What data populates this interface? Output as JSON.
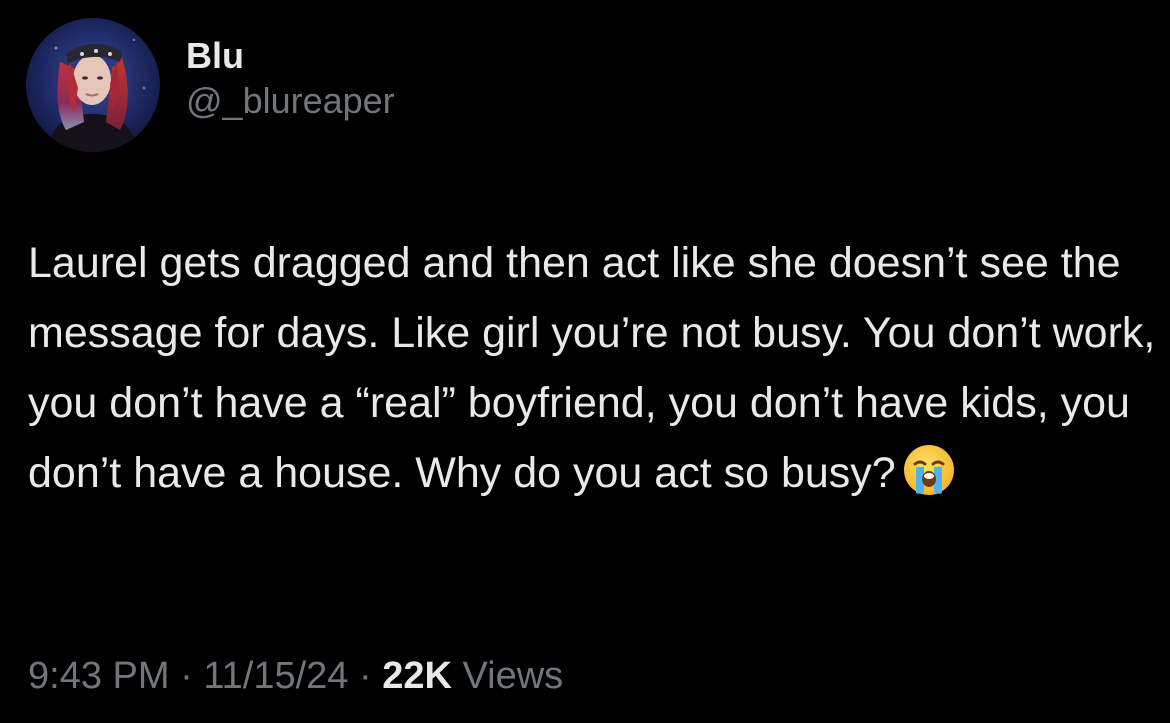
{
  "author": {
    "display_name": "Blu",
    "handle": "@_blureaper",
    "avatar_icon": "profile-photo"
  },
  "tweet": {
    "text": "Laurel gets dragged and then act like she doesn’t see the message for days. Like girl you’re not busy. You don’t work, you don’t have a “real” boyfriend, you don’t have kids, you don’t have a house. Why do you act so busy?",
    "emoji_icon": "loudly-crying-face-icon"
  },
  "meta": {
    "time": "9:43 PM",
    "separator": " · ",
    "date": "11/15/24",
    "views_count": "22K",
    "views_label": "Views"
  },
  "colors": {
    "background": "#000000",
    "primary_text": "#e7e9ea",
    "secondary_text": "#71767b"
  }
}
